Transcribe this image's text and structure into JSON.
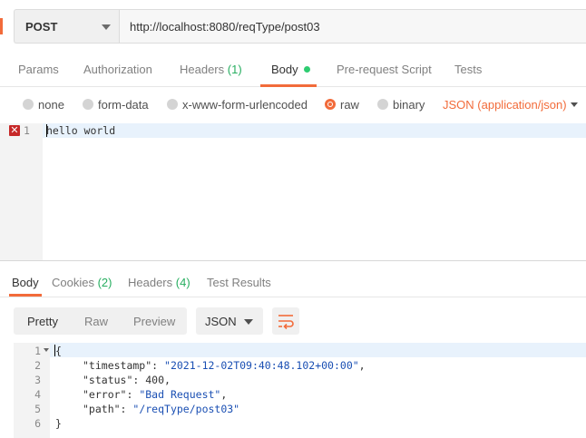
{
  "request": {
    "method": "POST",
    "url": "http://localhost:8080/reqType/post03"
  },
  "request_tabs": {
    "params": "Params",
    "authorization": "Authorization",
    "headers": "Headers",
    "headers_count": "(1)",
    "body": "Body",
    "pre_request_script": "Pre-request Script",
    "tests": "Tests"
  },
  "body_types": {
    "none": "none",
    "form_data": "form-data",
    "urlencoded": "x-www-form-urlencoded",
    "raw": "raw",
    "binary": "binary",
    "selected": "raw",
    "content_type": "JSON (application/json)"
  },
  "request_body": {
    "line_number": "1",
    "content": "hello world"
  },
  "response_tabs": {
    "body": "Body",
    "cookies": "Cookies",
    "cookies_count": "(2)",
    "headers": "Headers",
    "headers_count": "(4)",
    "test_results": "Test Results"
  },
  "response_toolbar": {
    "pretty": "Pretty",
    "raw": "Raw",
    "preview": "Preview",
    "format": "JSON"
  },
  "response_body": {
    "line_numbers": [
      "1",
      "2",
      "3",
      "4",
      "5",
      "6"
    ],
    "open_brace": "{",
    "close_brace": "}",
    "fields": [
      {
        "key": "\"timestamp\"",
        "value": "\"2021-12-02T09:40:48.102+00:00\"",
        "comma": ","
      },
      {
        "key": "\"status\"",
        "value": "400",
        "comma": ","
      },
      {
        "key": "\"error\"",
        "value": "\"Bad Request\"",
        "comma": ","
      },
      {
        "key": "\"path\"",
        "value": "\"/reqType/post03\"",
        "comma": ""
      }
    ]
  },
  "colors": {
    "accent": "#f26b3a",
    "count_green": "#27ae60",
    "error_red": "#c62828",
    "string_blue": "#1a4fb3"
  },
  "icons": [
    "chevron-down-icon",
    "error-icon",
    "fold-caret-icon",
    "wrap-lines-icon"
  ]
}
